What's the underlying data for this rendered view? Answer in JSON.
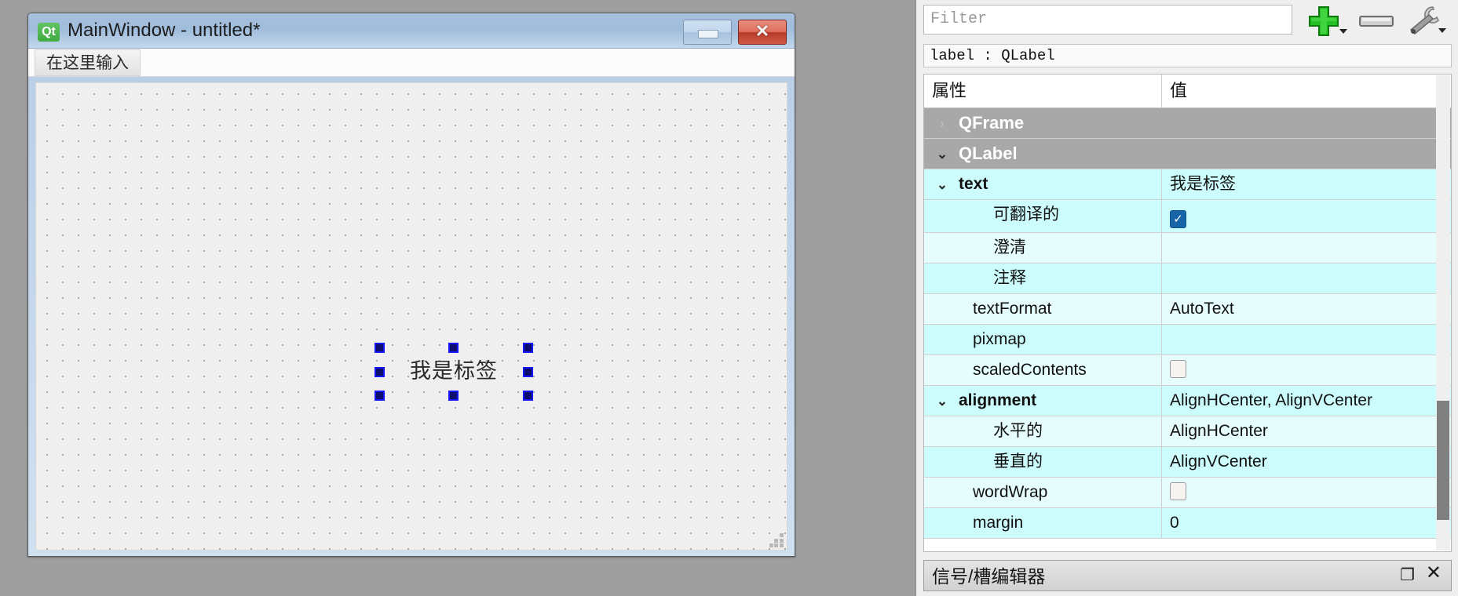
{
  "window": {
    "logo_text": "Qt",
    "title": "MainWindow - untitled*",
    "minimize_label": "",
    "close_label": "✕",
    "menu_placeholder": "在这里输入",
    "selected_widget_text": "我是标签"
  },
  "dock": {
    "filter_placeholder": "Filter",
    "filter_value": "",
    "add_icon": "plus-icon",
    "remove_icon": "minus-icon",
    "configure_icon": "wrench-icon",
    "object_line": "label : QLabel",
    "bottom_title": "信号/槽编辑器",
    "float_icon": "❐",
    "close_icon": "✕"
  },
  "table": {
    "header": {
      "name": "属性",
      "value": "值"
    },
    "rows": [
      {
        "kind": "group",
        "twisty": "›",
        "name": "QFrame",
        "value": ""
      },
      {
        "kind": "group",
        "twisty": "⌄",
        "name": "QLabel",
        "value": ""
      },
      {
        "kind": "prop",
        "twisty": "⌄",
        "indent": 0,
        "bold": true,
        "name": "text",
        "value": "我是标签",
        "shade": "c1"
      },
      {
        "kind": "prop",
        "twisty": "",
        "indent": 2,
        "bold": false,
        "name": "可翻译的",
        "value": "",
        "check": "on",
        "shade": "c1"
      },
      {
        "kind": "prop",
        "twisty": "",
        "indent": 2,
        "bold": false,
        "name": "澄清",
        "value": "",
        "shade": "c2"
      },
      {
        "kind": "prop",
        "twisty": "",
        "indent": 2,
        "bold": false,
        "name": "注释",
        "value": "",
        "shade": "c1"
      },
      {
        "kind": "prop",
        "twisty": "",
        "indent": 1,
        "bold": false,
        "name": "textFormat",
        "value": "AutoText",
        "shade": "c2"
      },
      {
        "kind": "prop",
        "twisty": "",
        "indent": 1,
        "bold": false,
        "name": "pixmap",
        "value": "",
        "shade": "c1"
      },
      {
        "kind": "prop",
        "twisty": "",
        "indent": 1,
        "bold": false,
        "name": "scaledContents",
        "value": "",
        "check": "off",
        "shade": "c2"
      },
      {
        "kind": "prop",
        "twisty": "⌄",
        "indent": 0,
        "bold": true,
        "name": "alignment",
        "value": "AlignHCenter, AlignVCenter",
        "shade": "c1"
      },
      {
        "kind": "prop",
        "twisty": "",
        "indent": 2,
        "bold": false,
        "name": "水平的",
        "value": "AlignHCenter",
        "shade": "c2"
      },
      {
        "kind": "prop",
        "twisty": "",
        "indent": 2,
        "bold": false,
        "name": "垂直的",
        "value": "AlignVCenter",
        "shade": "c1"
      },
      {
        "kind": "prop",
        "twisty": "",
        "indent": 1,
        "bold": false,
        "name": "wordWrap",
        "value": "",
        "check": "off",
        "shade": "c2"
      },
      {
        "kind": "prop",
        "twisty": "",
        "indent": 1,
        "bold": false,
        "name": "margin",
        "value": "0",
        "shade": "c1"
      }
    ]
  },
  "colors": {
    "group_row": "#a8a8a8",
    "row_shade_a": "#cdfcfc",
    "row_shade_b": "#e6fdfd",
    "selection_handle": "#1414ff",
    "checkbox_on": "#1565a8",
    "qt_green": "#3faa42",
    "close_red": "#b8392a"
  }
}
